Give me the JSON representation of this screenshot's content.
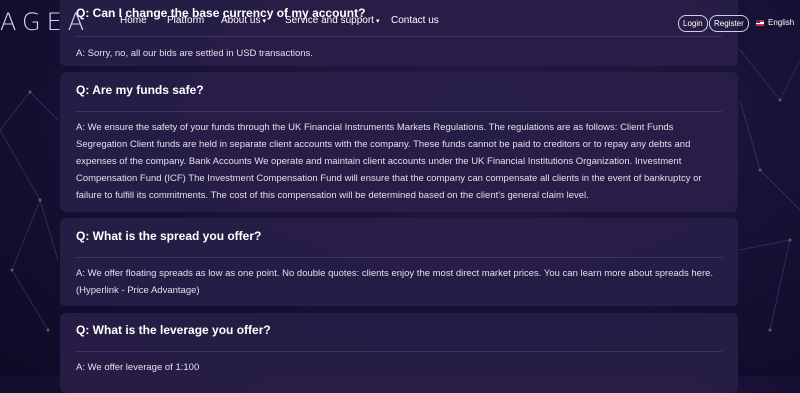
{
  "header": {
    "logo": "AGEA",
    "nav": [
      "Home",
      "Platform",
      "About us",
      "Service and support",
      "Contact us"
    ],
    "login": "Login",
    "register": "Register",
    "language": "English"
  },
  "faq": [
    {
      "question": "Q: Can I change the base currency of my account?",
      "answer": "A: Sorry, no, all our bids are settled in USD transactions."
    },
    {
      "question": "Q: Are my funds safe?",
      "answer": "A: We ensure the safety of your funds through the UK Financial Instruments Markets Regulations. The regulations are as follows: Client Funds Segregation Client funds are held in separate client accounts with the company. These funds cannot be paid to creditors or to repay any debts and expenses of the company. Bank Accounts We operate and maintain client accounts under the UK Financial Institutions Organization. Investment Compensation Fund (ICF) The Investment Compensation Fund will ensure that the company can compensate all clients in the event of bankruptcy or failure to fulfill its commitments. The cost of this compensation will be determined based on the client's general claim level."
    },
    {
      "question": "Q: What is the spread you offer?",
      "answer": "A: We offer floating spreads as low as one point. No double quotes: clients enjoy the most direct market prices. You can learn more about spreads here. (Hyperlink - Price Advantage)"
    },
    {
      "question": "Q: What is the leverage you offer?",
      "answer": "A: We offer leverage of 1:100"
    }
  ]
}
